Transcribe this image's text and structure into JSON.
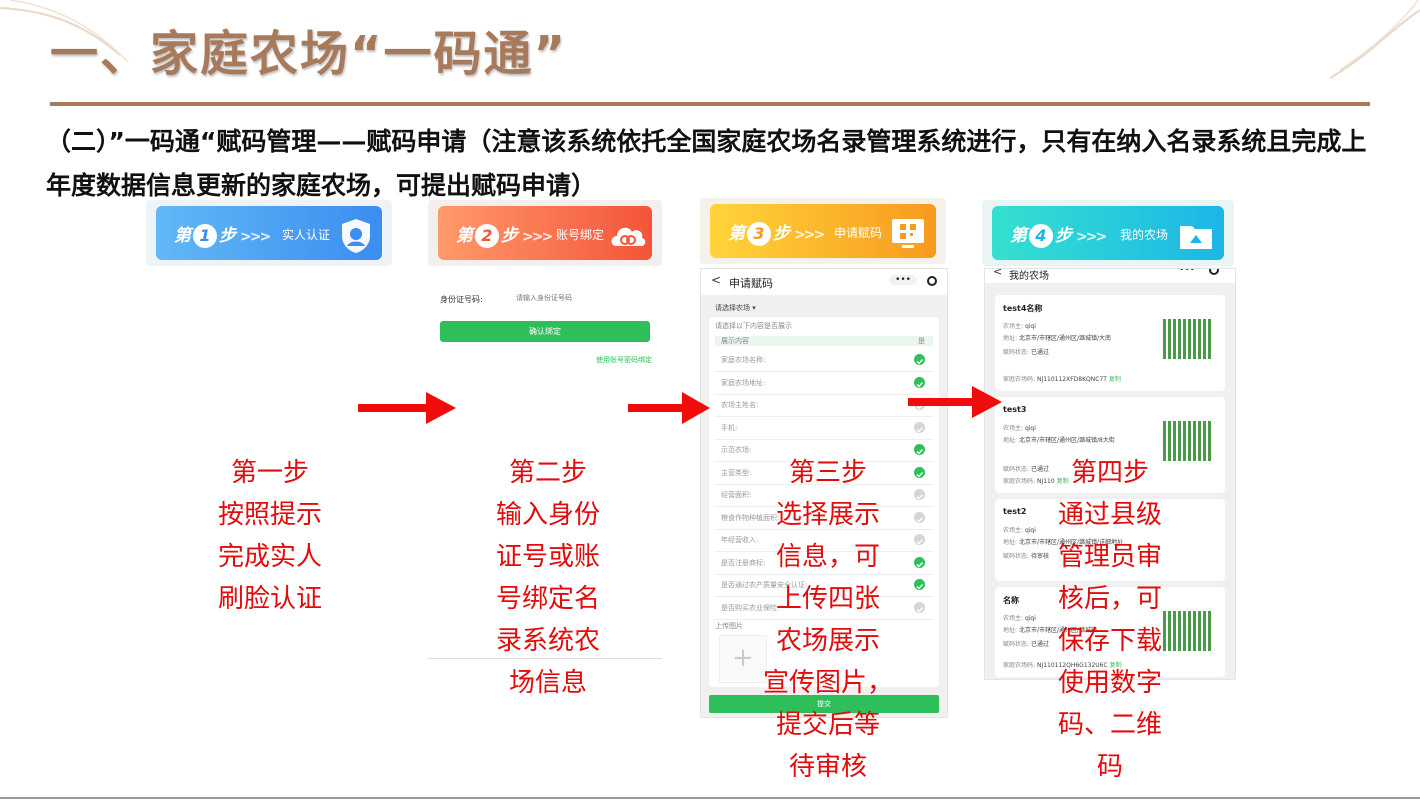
{
  "header": {
    "title": "一、家庭农场“一码通”",
    "subtitle": "（二）”一码通“赋码管理——赋码申请（注意该系统依托全国家庭农场名录管理系统进行，只有在纳入名录系统且完成上年度数据信息更新的家庭农场，可提出赋码申请）"
  },
  "steps": [
    {
      "badge_prefix": "第",
      "number": "1",
      "badge_suffix": "步",
      "label": "实人认证",
      "description": [
        "第一步",
        "按照提示",
        "完成实人",
        "刷脸认证"
      ],
      "colors": [
        "#5fb4f5",
        "#3b8df0"
      ]
    },
    {
      "badge_prefix": "第",
      "number": "2",
      "badge_suffix": "步",
      "label": "账号绑定",
      "description": [
        "第二步",
        "输入身份",
        "证号或账",
        "号绑定名",
        "录系统农",
        "场信息"
      ],
      "colors": [
        "#ff9a6a",
        "#f4543a"
      ]
    },
    {
      "badge_prefix": "第",
      "number": "3",
      "badge_suffix": "步",
      "label": "申请赋码",
      "description": [
        "第三步",
        "选择展示",
        "信息，可",
        "上传四张",
        "农场展示",
        "宣传图片，",
        "提交后等",
        "待审核"
      ],
      "colors": [
        "#ffd43b",
        "#f79a1f"
      ]
    },
    {
      "badge_prefix": "第",
      "number": "4",
      "badge_suffix": "步",
      "label": "我的农场",
      "description": [
        "第四步",
        "通过县级",
        "管理员审",
        "核后，可",
        "保存下载",
        "使用数字",
        "码、二维",
        "码"
      ],
      "colors": [
        "#35e0d0",
        "#1cb6e6"
      ]
    }
  ],
  "screen2": {
    "id_label": "身份证号码:",
    "id_placeholder": "请输入身份证号码",
    "confirm_button": "确认绑定",
    "alt_link": "使用账号密码绑定"
  },
  "screen3": {
    "back": "<",
    "title": "申请赋码",
    "menu_dots": "•••",
    "select_farm": "请选择农场 ▾",
    "hint": "请选择以下内容是否展示",
    "col_content": "展示内容",
    "col_yes": "是",
    "rows": [
      {
        "label": "家庭农场名称:",
        "checked": true
      },
      {
        "label": "家庭农场地址:",
        "checked": true
      },
      {
        "label": "农场主姓名:",
        "checked": false
      },
      {
        "label": "手机:",
        "checked": false
      },
      {
        "label": "示范农场:",
        "checked": true
      },
      {
        "label": "主营类型:",
        "checked": true
      },
      {
        "label": "经营面积:",
        "checked": false
      },
      {
        "label": "粮食作物种植面积:",
        "checked": false
      },
      {
        "label": "年经营收入:",
        "checked": false
      },
      {
        "label": "是否注册商标:",
        "checked": true
      },
      {
        "label": "是否通过农产质量安全认证:",
        "checked": true
      },
      {
        "label": "是否购买农业保险:",
        "checked": false
      }
    ],
    "upload_label": "上传图片",
    "submit": "提交"
  },
  "screen4": {
    "back": "<",
    "title": "我的农场",
    "menu_dots": "•••",
    "farms": [
      {
        "name": "test4名称",
        "owner_label": "农场主:",
        "owner": "qiqi",
        "addr_label": "地址:",
        "addr": "北京市/市辖区/通州区/潞城镇/大南",
        "status_label": "赋码状态:",
        "status": "已通过",
        "code_label": "家庭农场码:",
        "code": "NJ110112XFD8KQNC7T",
        "copy": "复制"
      },
      {
        "name": "test3",
        "owner_label": "农场主:",
        "owner": "qiqi",
        "addr_label": "地址:",
        "addr": "北京市/市辖区/通州区/潞城镇/8大街",
        "status_label": "赋码状态:",
        "status": "已通过",
        "code_label": "家庭农场码:",
        "code": "NJ110",
        "copy": "复制"
      },
      {
        "name": "test2",
        "owner_label": "农场主:",
        "owner": "qiqi",
        "addr_label": "地址:",
        "addr": "北京市/市辖区/通州区/潞城镇/详细地址",
        "status_label": "赋码状态:",
        "status": "待审核",
        "code_label": "",
        "code": "",
        "copy": ""
      },
      {
        "name": "名称",
        "owner_label": "农场主:",
        "owner": "qiqi",
        "addr_label": "地址:",
        "addr": "北京市/市辖区/通州区/潞城镇",
        "status_label": "赋码状态:",
        "status": "已通过",
        "code_label": "家庭农场码:",
        "code": "NJ110112QH6G132U6C",
        "copy": "复制"
      }
    ]
  },
  "colors": {
    "title": "#a67a5b",
    "red": "#e30b0b",
    "green": "#2fbf5a"
  }
}
